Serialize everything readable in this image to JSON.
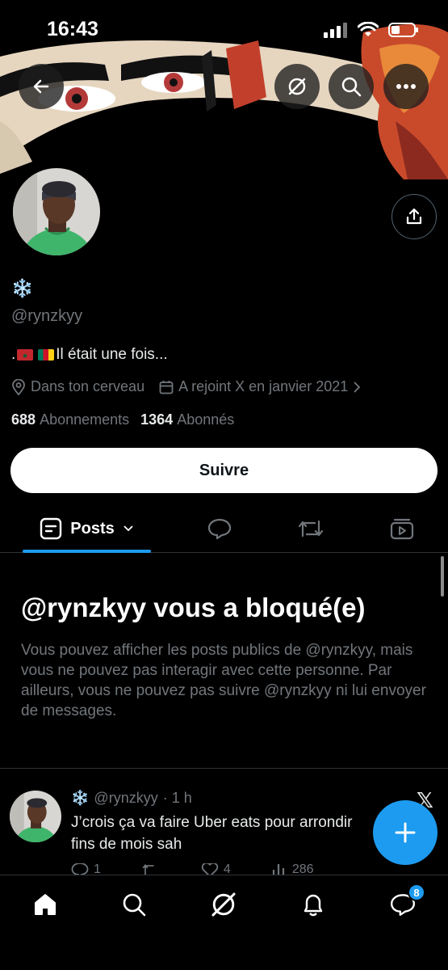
{
  "status_bar": {
    "time": "16:43"
  },
  "profile": {
    "display_name": "❄️",
    "handle": "@rynzkyy",
    "bio_prefix": ".",
    "bio_text": " Il était une fois...",
    "location": "Dans ton cerveau",
    "joined": "A rejoint X en janvier 2021",
    "following_count": "688",
    "following_label": "Abonnements",
    "followers_count": "1364",
    "followers_label": "Abonnés",
    "follow_button": "Suivre"
  },
  "tabs": {
    "posts_label": "Posts"
  },
  "blocked": {
    "title": "@rynzkyy vous a bloqué(e)",
    "text": "Vous pouvez afficher les posts publics de @rynzkyy, mais vous ne pouvez pas interagir avec cette personne. Par ailleurs, vous ne pouvez pas suivre @rynzkyy ni lui envoyer de messages."
  },
  "tweet": {
    "author_name": "❄️",
    "author_handle": "@rynzkyy",
    "time": "· 1 h",
    "text_line1": "J’crois ça va faire Uber eats pour arrondir",
    "text_line2": "fins de mois sah",
    "replies": "1",
    "likes": "4",
    "views": "286"
  },
  "bottom_nav": {
    "messages_badge": "8"
  },
  "colors": {
    "accent": "#1d9bf0",
    "background": "#000000",
    "muted": "#71767b"
  },
  "icons": [
    "back-arrow-icon",
    "grok-icon",
    "search-icon",
    "more-icon",
    "share-icon",
    "location-icon",
    "calendar-icon",
    "chevron-right-icon",
    "posts-icon",
    "chevron-down-icon",
    "replies-icon",
    "reposts-icon",
    "media-icon",
    "compose-icon",
    "home-icon",
    "notifications-icon",
    "messages-icon"
  ]
}
